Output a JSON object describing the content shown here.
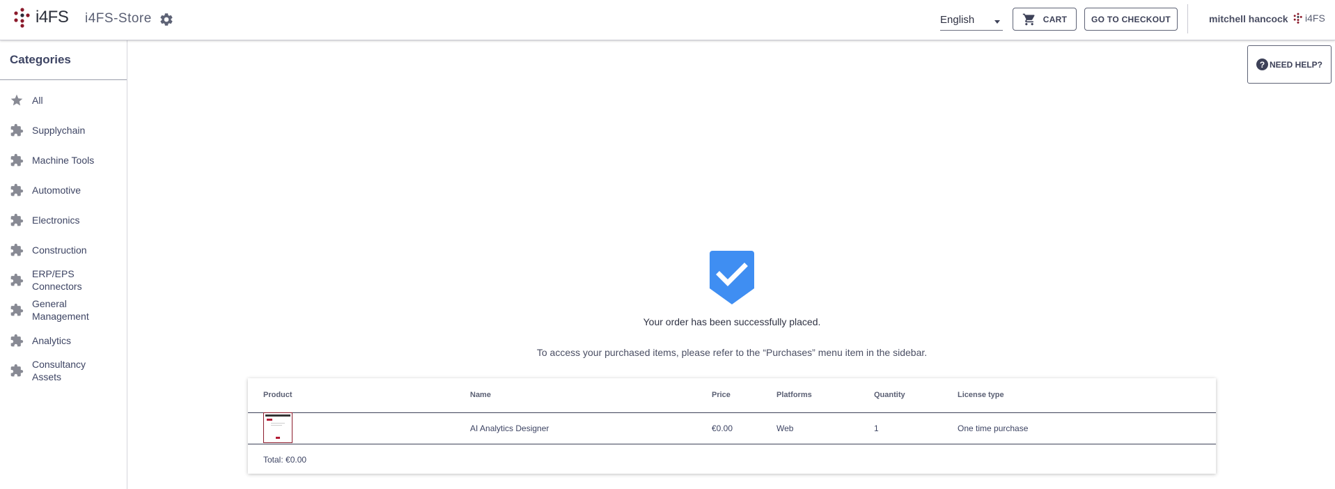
{
  "header": {
    "logo_text": "i4FS",
    "store_title": "i4FS-Store",
    "language": "English",
    "cart_label": "CART",
    "checkout_label": "GO TO CHECKOUT",
    "user_name": "mitchell hancock",
    "brand_small": "i4FS"
  },
  "sidebar": {
    "title": "Categories",
    "items": [
      {
        "label": "All",
        "icon": "star-icon"
      },
      {
        "label": "Supplychain",
        "icon": "puzzle-icon"
      },
      {
        "label": "Machine Tools",
        "icon": "puzzle-icon"
      },
      {
        "label": "Automotive",
        "icon": "puzzle-icon"
      },
      {
        "label": "Electronics",
        "icon": "puzzle-icon"
      },
      {
        "label": "Construction",
        "icon": "puzzle-icon"
      },
      {
        "label": "ERP/EPS Connectors",
        "icon": "puzzle-icon"
      },
      {
        "label": "General Management",
        "icon": "puzzle-icon"
      },
      {
        "label": "Analytics",
        "icon": "puzzle-icon"
      },
      {
        "label": "Consultancy Assets",
        "icon": "puzzle-icon"
      }
    ]
  },
  "help": {
    "label": "NEED HELP?"
  },
  "success": {
    "message": "Your order has been successfully placed.",
    "instruction": "To access your purchased items, please refer to the “Purchases” menu item in the sidebar."
  },
  "order_table": {
    "headers": [
      "Product",
      "Name",
      "Price",
      "Platforms",
      "Quantity",
      "License type"
    ],
    "rows": [
      {
        "name": "AI Analytics Designer",
        "price": "€0.00",
        "platforms": "Web",
        "quantity": "1",
        "license": "One time purchase"
      }
    ],
    "total": "Total: €0.00"
  },
  "colors": {
    "accent_blue": "#3f8ef2",
    "brand_red": "#8b1a2b",
    "text_primary": "#3d4463"
  }
}
